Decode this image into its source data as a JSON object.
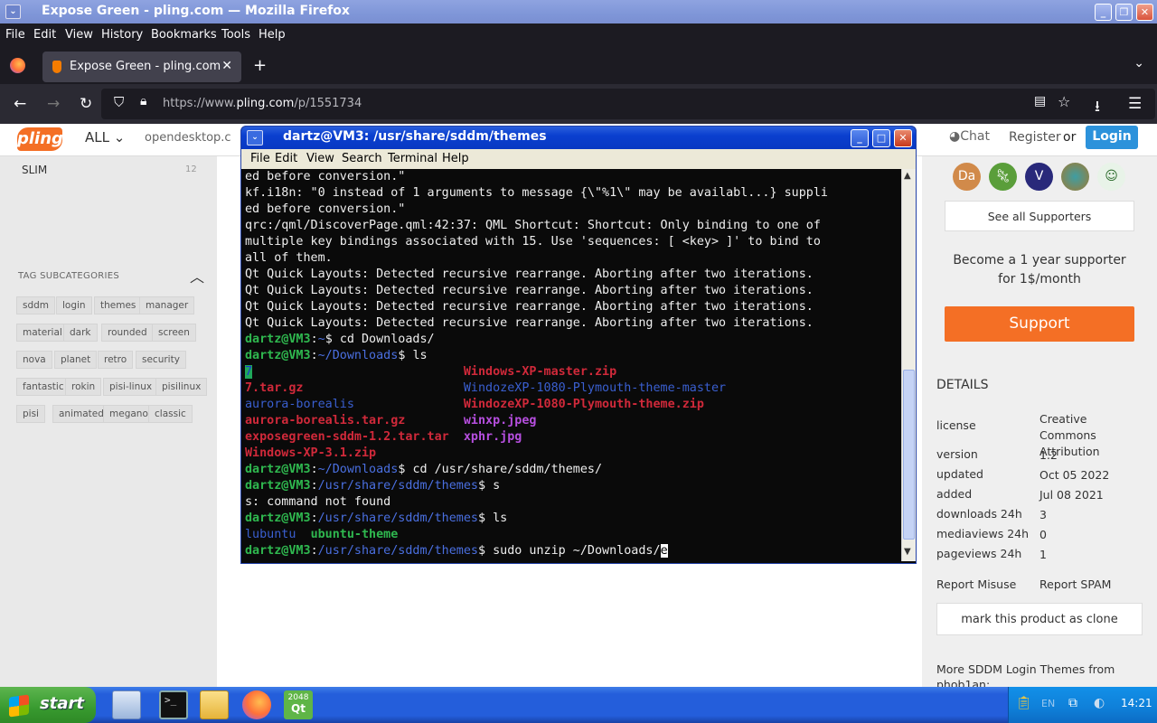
{
  "firefox": {
    "window_title": "Expose Green - pling.com — Mozilla Firefox",
    "menu": [
      "File",
      "Edit",
      "View",
      "History",
      "Bookmarks",
      "Tools",
      "Help"
    ],
    "tab_title": "Expose Green - pling.com",
    "url_prefix": "https://www.",
    "url_domain": "pling.com",
    "url_path": "/p/1551734"
  },
  "site_header": {
    "logo": "pling",
    "all_label": "ALL",
    "opendesktop": "opendesktop.c",
    "chat": "Chat",
    "register": "Register",
    "or": "or",
    "login": "Login"
  },
  "left": {
    "slim_label": "SLIM",
    "slim_count": "12",
    "tag_header": "TAG SUBCATEGORIES",
    "tags": [
      "sddm",
      "login",
      "themes",
      "manager",
      "material",
      "dark",
      "rounded",
      "screen",
      "nova",
      "planet",
      "retro",
      "security",
      "fantastic",
      "rokin",
      "pisi-linux",
      "pisilinux",
      "pisi",
      "animated",
      "megano",
      "classic"
    ]
  },
  "right": {
    "avatars": [
      "Da",
      "",
      "V",
      "",
      ""
    ],
    "see_all": "See all Supporters",
    "become": "Become a 1 year supporter for 1$/month",
    "support_btn": "Support",
    "details_header": "DETAILS",
    "details": [
      {
        "k": "license",
        "v": "Creative Commons Attribution"
      },
      {
        "k": "version",
        "v": "1.2"
      },
      {
        "k": "updated",
        "v": "Oct 05 2022"
      },
      {
        "k": "added",
        "v": "Jul 08 2021"
      },
      {
        "k": "downloads 24h",
        "v": "3"
      },
      {
        "k": "mediaviews 24h",
        "v": "0"
      },
      {
        "k": "pageviews 24h",
        "v": "1"
      }
    ],
    "report_misuse": "Report Misuse",
    "report_spam": "Report SPAM",
    "clone_btn": "mark this product as clone",
    "more_header": "More SDDM Login Themes from phob1an:"
  },
  "terminal": {
    "title": "dartz@VM3: /usr/share/sddm/themes",
    "menu": [
      "File",
      "Edit",
      "View",
      "Search",
      "Terminal",
      "Help"
    ],
    "lines": [
      "ed before conversion.\"",
      "kf.i18n: \"0 instead of 1 arguments to message {\\\"%1\\\" may be availabl...} suppli",
      "ed before conversion.\"",
      "qrc:/qml/DiscoverPage.qml:42:37: QML Shortcut: Shortcut: Only binding to one of",
      "multiple key bindings associated with 15. Use 'sequences: [ <key> ]' to bind to",
      "all of them.",
      "Qt Quick Layouts: Detected recursive rearrange. Aborting after two iterations.",
      "Qt Quick Layouts: Detected recursive rearrange. Aborting after two iterations.",
      "Qt Quick Layouts: Detected recursive rearrange. Aborting after two iterations.",
      "Qt Quick Layouts: Detected recursive rearrange. Aborting after two iterations."
    ],
    "prompt_user": "dartz@VM3",
    "cmd1_dir": "~",
    "cmd1": "cd Downloads/",
    "cmd2_dir": "~/Downloads",
    "cmd2": "ls",
    "ls_col1": [
      "7",
      "7.tar.gz",
      "aurora-borealis",
      "aurora-borealis.tar.gz",
      "exposegreen-sddm-1.2.tar.tar",
      "Windows-XP-3.1.zip"
    ],
    "ls_col2": [
      "Windows-XP-master.zip",
      "WindozeXP-1080-Plymouth-theme-master",
      "WindozeXP-1080-Plymouth-theme.zip",
      "winxp.jpeg",
      "xphr.jpg"
    ],
    "cmd3_dir": "~/Downloads",
    "cmd3": "cd /usr/share/sddm/themes/",
    "cmd4_dir": "/usr/share/sddm/themes",
    "cmd4": "s",
    "err": "s: command not found",
    "cmd5_dir": "/usr/share/sddm/themes",
    "cmd5": "ls",
    "ls2": [
      "lubuntu",
      "ubuntu-theme"
    ],
    "cmd6_dir": "/usr/share/sddm/themes",
    "cmd6": "sudo unzip ~/Downloads/",
    "cursor_char": "e"
  },
  "taskbar": {
    "start": "start",
    "qt_badge": "2048",
    "qt_label": "Qt",
    "clock": "14:21",
    "lang": "EN"
  }
}
